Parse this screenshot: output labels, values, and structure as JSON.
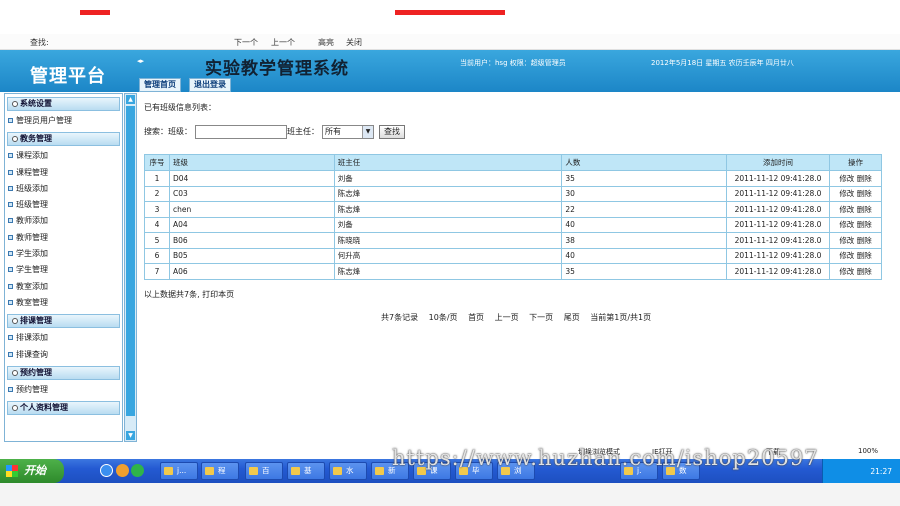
{
  "find_bar": {
    "find_label": "查找:",
    "next": "下一个",
    "prev": "上一个",
    "highlight": "高亮",
    "close": "关闭"
  },
  "header": {
    "logo": "管理平台",
    "system_title": "实验教学管理系统",
    "user_info": "当前用户：hsg 权限：超级管理员",
    "date_info": "2012年5月18日 星期五 农历壬辰年 四月廿八",
    "collapse_icon": "◂▸",
    "tabs": [
      "管理首页",
      "退出登录"
    ]
  },
  "sidebar": {
    "groups": [
      {
        "title": "系统设置",
        "items": [
          "管理员用户管理"
        ]
      },
      {
        "title": "教务管理",
        "items": [
          "课程添加",
          "课程管理",
          "班级添加",
          "班级管理",
          "教师添加",
          "教师管理",
          "学生添加",
          "学生管理",
          "教室添加",
          "教室管理"
        ]
      },
      {
        "title": "排课管理",
        "items": [
          "排课添加",
          "排课查询"
        ]
      },
      {
        "title": "预约管理",
        "items": [
          "预约管理"
        ]
      },
      {
        "title": "个人资料管理",
        "items": []
      }
    ]
  },
  "main": {
    "existing_label": "已有班级信息列表：",
    "search": {
      "label": "搜索：",
      "class_label": "班级：",
      "class_value": "",
      "teacher_label": "班主任：",
      "teacher_selected": "所有",
      "button": "查找"
    },
    "table": {
      "headers": [
        "序号",
        "班级",
        "班主任",
        "人数",
        "添加时间",
        "操作"
      ],
      "rows": [
        [
          "1",
          "D04",
          "刘备",
          "35",
          "2011-11-12 09:41:28.0"
        ],
        [
          "2",
          "C03",
          "陈志烽",
          "30",
          "2011-11-12 09:41:28.0"
        ],
        [
          "3",
          "chen",
          "陈志烽",
          "22",
          "2011-11-12 09:41:28.0"
        ],
        [
          "4",
          "A04",
          "刘备",
          "40",
          "2011-11-12 09:41:28.0"
        ],
        [
          "5",
          "B06",
          "陈晓晓",
          "38",
          "2011-11-12 09:41:28.0"
        ],
        [
          "6",
          "B05",
          "何升高",
          "40",
          "2011-11-12 09:41:28.0"
        ],
        [
          "7",
          "A06",
          "陈志烽",
          "35",
          "2011-11-12 09:41:28.0"
        ]
      ],
      "edit_label": "修改",
      "delete_label": "删除"
    },
    "summary": "以上数据共7条, 打印本页",
    "pager": [
      "共7条记录",
      "10条/页",
      "首页",
      "上一页",
      "下一页",
      "尾页",
      "当前第1页/共1页"
    ]
  },
  "statusbar": {
    "mode": "切换浏览模式",
    "ie": "IE打开",
    "download": "下载",
    "zoom": "100%"
  },
  "taskbar": {
    "start": "开始",
    "buttons": [
      "j...",
      "程",
      "百",
      "基",
      "水",
      "新",
      "课",
      "毕",
      "浏",
      "j.",
      "数"
    ],
    "clock": "21:27"
  },
  "watermark": "https://www.huzhan.com/ishop20597"
}
